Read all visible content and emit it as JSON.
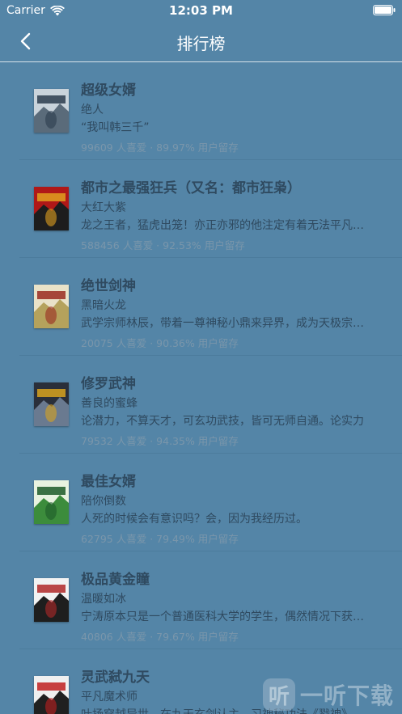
{
  "status_bar": {
    "carrier": "Carrier",
    "time": "12:03 PM"
  },
  "nav": {
    "title": "排行榜",
    "back_icon": "chevron-left-icon"
  },
  "books": [
    {
      "title": "超级女婿",
      "author": "绝人",
      "description": "“我叫韩三千”",
      "stats": "99609 人喜爱 · 89.97% 用户留存",
      "cover_colors": [
        "#c9d3db",
        "#5a6b7a",
        "#2b3c4d"
      ]
    },
    {
      "title": "都市之最强狂兵（又名：都市狂枭）",
      "author": "大红大紫",
      "description": "龙之王者，猛虎出笼！亦正亦邪的他注定有着无法平凡的人生",
      "stats": "588456 人喜爱 · 92.53% 用户留存",
      "cover_colors": [
        "#b01818",
        "#1d1d1d",
        "#e0a020"
      ]
    },
    {
      "title": "绝世剑神",
      "author": "黑暗火龙",
      "description": "武学宗师林辰，带着一尊神秘小鼎来异界，成为天极宗的弟子",
      "stats": "20075 人喜爱 · 90.36% 用户留存",
      "cover_colors": [
        "#e9e2c8",
        "#b5a25c",
        "#9a2a20"
      ]
    },
    {
      "title": "修罗武神",
      "author": "善良的蜜蜂",
      "description": "论潜力，不算天才，可玄功武技，皆可无师自通。论实力",
      "stats": "79532 人喜爱 · 94.35% 用户留存",
      "cover_colors": [
        "#2a2f3a",
        "#6a7a90",
        "#d7a21f"
      ]
    },
    {
      "title": "最佳女婿",
      "author": "陪你倒数",
      "description": "人死的时候会有意识吗？会，因为我经历过。",
      "stats": "62795 人喜爱 · 79.49% 用户留存",
      "cover_colors": [
        "#e8f2e0",
        "#3c8c3c",
        "#1c5a28"
      ]
    },
    {
      "title": "极品黄金瞳",
      "author": "温暖如冰",
      "description": "宁涛原本只是一个普通医科大学的学生，偶然情况下获得了神奇的能力",
      "stats": "40806 人喜爱 · 79.67% 用户留存",
      "cover_colors": [
        "#f2f2f2",
        "#1e1e1e",
        "#b02828"
      ]
    },
    {
      "title": "灵武弑九天",
      "author": "平凡魔术师",
      "description": "叶扬穿越异世，在九天玄剑认主，习神秘功法《戮神》",
      "stats": "",
      "cover_colors": [
        "#f0f0f0",
        "#202020",
        "#c02020"
      ]
    }
  ],
  "watermark": {
    "logo_text": "听",
    "text": "一听下载"
  }
}
